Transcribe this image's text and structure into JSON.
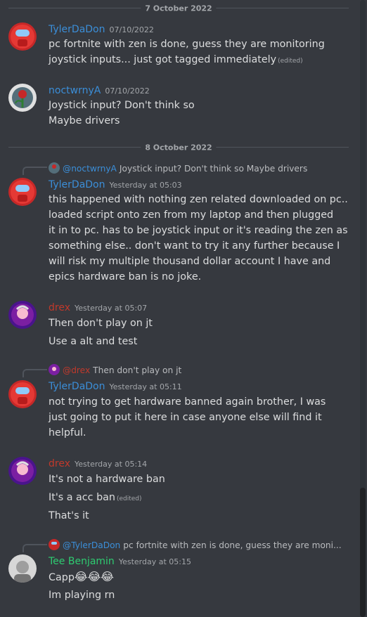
{
  "colors": {
    "tyler": "#3b8ed8",
    "noct": "#3b8ed8",
    "drex": "#c0392b",
    "tee": "#2ecc71",
    "text": "#dcddde",
    "muted": "#a3a6aa"
  },
  "dividers": [
    "7 October 2022",
    "8 October 2022"
  ],
  "messages": [
    {
      "username": "TylerDaDon",
      "timestamp": "07/10/2022",
      "lines": [
        "pc fortnite with zen is done, guess they are monitoring",
        "joystick inputs... just got tagged immediately"
      ],
      "edited": "(edited)"
    },
    {
      "username": "noctwrnyA",
      "timestamp": "07/10/2022",
      "lines": [
        "Joystick input? Don't think so",
        "Maybe drivers"
      ]
    },
    {
      "reply_to": {
        "name": "@noctwrnyA",
        "text": "Joystick input? Don't think so Maybe drivers"
      },
      "username": "TylerDaDon",
      "timestamp": "Yesterday at 05:03",
      "lines": [
        "this happened with nothing zen related downloaded on pc..",
        " loaded script onto zen from my laptop and then plugged",
        "it in to pc. has to be joystick input or it's reading the zen as",
        "something else.. don't want to try it any further because I",
        "will risk my multiple thousand dollar account I have and",
        "epics hardware ban is no joke."
      ]
    },
    {
      "username": "drex",
      "timestamp": "Yesterday at 05:07",
      "lines": [
        "Then don't play on jt",
        "Use a alt and test"
      ]
    },
    {
      "reply_to": {
        "name": "@drex",
        "text": "Then don't play on jt"
      },
      "username": "TylerDaDon",
      "timestamp": "Yesterday at 05:11",
      "lines": [
        "not trying to get hardware banned again brother, I  was",
        "just going to put it here in case anyone else will  find it",
        "helpful."
      ]
    },
    {
      "username": "drex",
      "timestamp": "Yesterday at 05:14",
      "lines": [
        "It's not a hardware ban",
        "It's a acc ban",
        "That's it"
      ],
      "edited": "(edited)"
    },
    {
      "reply_to": {
        "name": "@TylerDaDon",
        "text": "pc fortnite with zen is done, guess they are moni..."
      },
      "username": "Tee Benjamin",
      "timestamp": "Yesterday at 05:15",
      "lines": [
        "Capp",
        "Im playing rn"
      ],
      "emoji": "😂😂😂"
    }
  ]
}
